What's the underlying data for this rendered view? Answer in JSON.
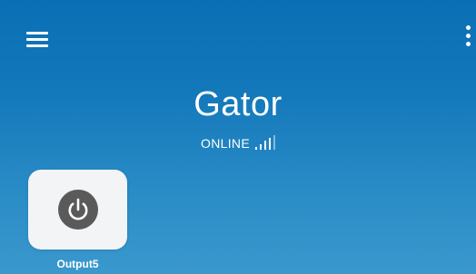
{
  "app": {
    "menu_icon": "hamburger-menu-icon",
    "more_icon": "more-vertical-icon"
  },
  "device": {
    "name": "Gator",
    "status": "ONLINE",
    "signal_icon": "signal-strength-icon",
    "signal_bars_active": 4,
    "signal_bars_total": 5
  },
  "outputs": [
    {
      "label": "Output5",
      "icon": "power-icon",
      "state": "off"
    }
  ],
  "colors": {
    "background_top": "#0a6fb4",
    "background_bottom": "#3a98cd",
    "card_bg": "#f2f4f6",
    "power_button": "#5a5a5a",
    "text": "#ffffff"
  }
}
